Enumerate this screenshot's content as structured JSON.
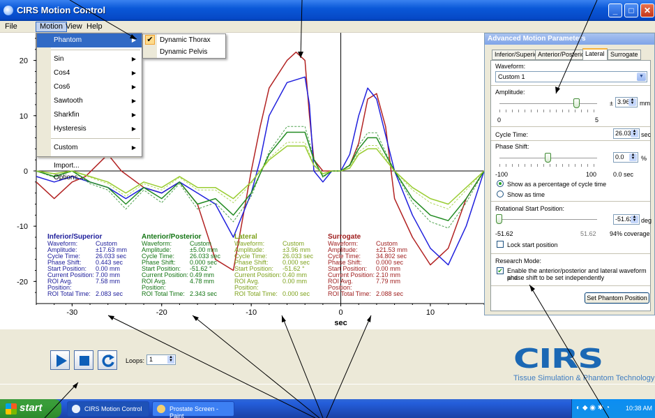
{
  "window": {
    "title": "CIRS Motion Control",
    "controls": [
      "_",
      "□",
      "✕"
    ]
  },
  "menubar": {
    "items": [
      "File",
      "Motion",
      "View",
      "Help"
    ],
    "active": "Motion"
  },
  "motion_menu": {
    "items": [
      {
        "label": "Phantom",
        "submenu": true,
        "highlighted": true
      },
      {
        "label": "Sin",
        "submenu": true
      },
      {
        "label": "Cos4",
        "submenu": true
      },
      {
        "label": "Cos6",
        "submenu": true
      },
      {
        "label": "Sawtooth",
        "submenu": true
      },
      {
        "label": "Sharkfin",
        "submenu": true
      },
      {
        "label": "Hysteresis",
        "submenu": true
      },
      {
        "label": "Custom",
        "submenu": true
      },
      {
        "label": "Import...",
        "submenu": false
      },
      {
        "label": "Options...",
        "submenu": false
      }
    ],
    "phantom_submenu": [
      {
        "label": "Dynamic Thorax",
        "checked": true
      },
      {
        "label": "Dynamic Pelvis",
        "checked": false
      }
    ]
  },
  "chart_data": {
    "type": "line",
    "xlabel": "sec",
    "xlim": [
      -34,
      16
    ],
    "ylim": [
      -24,
      25
    ],
    "x_ticks": [
      -30,
      -20,
      -10,
      0,
      10
    ],
    "y_ticks": [
      20,
      10,
      0,
      -10,
      -20
    ],
    "series": [
      {
        "name": "Surrogate",
        "color": "#b22222",
        "x": [
          -34,
          -32,
          -30,
          -28.5,
          -26,
          -24.5,
          -22,
          -20,
          -18,
          -16,
          -14,
          -12,
          -10,
          -9,
          -8,
          -6,
          -5,
          -4,
          -3.5,
          -3,
          -2,
          -1,
          0,
          1,
          2,
          3,
          4,
          5,
          6,
          8,
          10,
          12,
          14,
          16
        ],
        "y": [
          -2,
          -5,
          -2,
          -1,
          3,
          0,
          -3,
          -4,
          -2,
          -6,
          -16,
          -18,
          0,
          8,
          15,
          20,
          21.5,
          20,
          10,
          2,
          0,
          0,
          0,
          1,
          5,
          13,
          14,
          8,
          -5,
          -12,
          -17,
          -14,
          -5,
          0
        ]
      },
      {
        "name": "Inferior/Superior",
        "color": "#2020dd",
        "x": [
          -34,
          -32,
          -30,
          -28,
          -26,
          -24,
          -22,
          -20,
          -18,
          -16,
          -14,
          -12,
          -10,
          -9,
          -8,
          -6,
          -4,
          -3.5,
          -3,
          -2,
          -1,
          0,
          1,
          2,
          3,
          4,
          6,
          8,
          10,
          12,
          14,
          16
        ],
        "y": [
          -1,
          -2,
          -1,
          -2,
          -3,
          -5,
          -3,
          -4,
          -2,
          -4,
          -6,
          -12,
          -4,
          2,
          10,
          16,
          17,
          12,
          0,
          -2,
          0,
          0,
          3,
          10,
          15,
          13,
          0,
          -8,
          -14,
          -17,
          -10,
          0
        ]
      },
      {
        "name": "Anterior/Posterior",
        "color": "#228b22",
        "x": [
          -34,
          -32,
          -30,
          -28,
          -26,
          -24,
          -22,
          -20,
          -18,
          -16,
          -14,
          -12,
          -10,
          -8,
          -6,
          -4,
          -3,
          -2,
          -1,
          0,
          1,
          2,
          3,
          4,
          6,
          8,
          10,
          12,
          14,
          16
        ],
        "y": [
          0,
          -1,
          0,
          -2,
          -3,
          -6,
          -3,
          -5,
          -2,
          -6,
          -5,
          -8,
          -4,
          3,
          7,
          7,
          2,
          -1,
          0,
          0,
          1,
          4,
          6,
          6,
          0,
          -5,
          -8,
          -9,
          -5,
          0
        ]
      },
      {
        "name": "Lateral",
        "color": "#9acd32",
        "x": [
          -34,
          -32,
          -30,
          -28,
          -26,
          -24,
          -22,
          -20,
          -18,
          -16,
          -14,
          -12,
          -10,
          -8,
          -6,
          -4,
          -3,
          -2,
          -1,
          0,
          1,
          2,
          3,
          4,
          6,
          8,
          10,
          12,
          14,
          16
        ],
        "y": [
          0,
          -0.5,
          0,
          -1,
          -2,
          -4,
          -2,
          -3,
          -1,
          -3,
          -3,
          -5,
          -2,
          2,
          4.5,
          4.5,
          1,
          -0.5,
          0,
          0,
          0.5,
          3,
          4,
          4,
          0,
          -3,
          -5,
          -6,
          -3,
          0
        ]
      }
    ]
  },
  "stats": [
    {
      "title": "Inferior/Superior",
      "color": "#1c1c9a",
      "rows": [
        [
          "Waveform:",
          "Custom"
        ],
        [
          "Amplitude:",
          "±17.63 mm"
        ],
        [
          "Cycle Time:",
          "26.033 sec"
        ],
        [
          "Phase Shift:",
          "0.443 sec"
        ],
        [
          "Start Position:",
          "0.00 mm"
        ],
        [
          "Current Position:",
          "7.00 mm"
        ],
        [
          "ROI Avg. Position:",
          "7.58 mm"
        ],
        [
          "ROI Total Time:",
          "2.083 sec"
        ]
      ]
    },
    {
      "title": "Anterior/Posterior",
      "color": "#137513",
      "rows": [
        [
          "Waveform:",
          "Custom"
        ],
        [
          "Amplitude:",
          "±5.00 mm"
        ],
        [
          "Cycle Time:",
          "26.033 sec"
        ],
        [
          "Phase Shift:",
          "0.000 sec"
        ],
        [
          "Start Position:",
          "-51.62 °"
        ],
        [
          "Current Position:",
          "0.49 mm"
        ],
        [
          "ROI Avg. Position:",
          "4.78 mm"
        ],
        [
          "ROI Total Time:",
          "2.343 sec"
        ]
      ]
    },
    {
      "title": "Lateral",
      "color": "#7ea21c",
      "rows": [
        [
          "Waveform:",
          "Custom"
        ],
        [
          "Amplitude:",
          "±3.96 mm"
        ],
        [
          "Cycle Time:",
          "26.033 sec"
        ],
        [
          "Phase Shift:",
          "0.000 sec"
        ],
        [
          "Start Position:",
          "-51.62 °"
        ],
        [
          "Current Position:",
          "0.40 mm"
        ],
        [
          "ROI Avg. Position:",
          "0.00 mm"
        ],
        [
          "ROI Total Time:",
          "0.000 sec"
        ]
      ]
    },
    {
      "title": "Surrogate",
      "color": "#9e1b1b",
      "rows": [
        [
          "Waveform:",
          "Custom"
        ],
        [
          "Amplitude:",
          "±21.53 mm"
        ],
        [
          "Cycle Time:",
          "34.802 sec"
        ],
        [
          "Phase Shift:",
          "0.000 sec"
        ],
        [
          "Start Position:",
          "0.00 mm"
        ],
        [
          "Current Position:",
          "2.10 mm"
        ],
        [
          "ROI Avg. Position:",
          "7.79 mm"
        ],
        [
          "ROI Total Time:",
          "2.088 sec"
        ]
      ]
    }
  ],
  "panel": {
    "title": "Advanced Motion Parameters",
    "tabs": [
      "Inferior/Superior",
      "Anterior/Posterior",
      "Lateral",
      "Surrogate"
    ],
    "active_tab": "Lateral",
    "waveform_label": "Waveform:",
    "waveform_value": "Custom 1",
    "amplitude_label": "Amplitude:",
    "amplitude_prefix": "±",
    "amplitude_value": "3.96",
    "amplitude_unit": "mm",
    "amplitude_min": "0",
    "amplitude_max": "5",
    "amplitude_level": 0.79,
    "cycle_label": "Cycle Time:",
    "cycle_value": "26.033",
    "cycle_unit": "sec",
    "phase_label": "Phase Shift:",
    "phase_value": "0.0",
    "phase_unit": "%",
    "phase_min": "-100",
    "phase_max": "100",
    "phase_sec": "0.0 sec",
    "phase_level": 0.5,
    "radio_percent": "Show as a percentage of cycle time",
    "radio_time": "Show as time",
    "rot_label": "Rotational Start Position:",
    "rot_value": "-51.62",
    "rot_unit": "deg",
    "rot_min": "-51.62",
    "rot_max": "51.62",
    "rot_coverage": "94% coverage",
    "rot_level": 0.0,
    "lock_label": "Lock start position",
    "research_label": "Research Mode:",
    "research_text_1": "Enable the anterior/posterior and lateral waveform and",
    "research_text_2": "phase shift to be set independently",
    "set_button": "Set Phantom Position"
  },
  "controls": {
    "loops_label": "Loops:",
    "loops_value": "1"
  },
  "logo": {
    "text": "CIRS",
    "tagline": "Tissue Simulation & Phantom Technology"
  },
  "taskbar": {
    "start": "start",
    "tasks": [
      "CIRS Motion Control",
      "Prostate Screen - Paint"
    ],
    "clock": "10:38 AM"
  }
}
